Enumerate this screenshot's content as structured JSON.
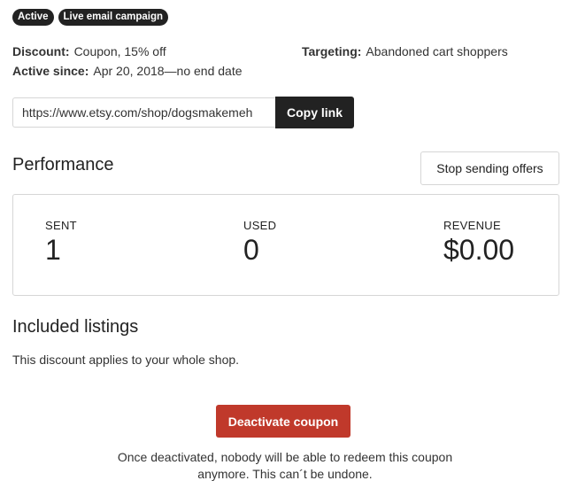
{
  "badges": [
    "Active",
    "Live email campaign"
  ],
  "details": {
    "discount_label": "Discount:",
    "discount_value": "Coupon, 15% off",
    "active_since_label": "Active since:",
    "active_since_value": "Apr 20, 2018—no end date",
    "targeting_label": "Targeting:",
    "targeting_value": "Abandoned cart shoppers"
  },
  "share": {
    "link_value": "https://www.etsy.com/shop/dogsmakemeh",
    "copy_label": "Copy link"
  },
  "performance": {
    "title": "Performance",
    "stop_label": "Stop sending offers",
    "stats": [
      {
        "label": "SENT",
        "value": "1"
      },
      {
        "label": "USED",
        "value": "0"
      },
      {
        "label": "REVENUE",
        "value": "$0.00"
      }
    ]
  },
  "listings": {
    "title": "Included listings",
    "description": "This discount applies to your whole shop."
  },
  "deactivate": {
    "button_label": "Deactivate coupon",
    "warning": "Once deactivated, nobody will be able to redeem this coupon anymore. This can´t be undone."
  },
  "colors": {
    "badge_bg": "#222222",
    "danger": "#c0392b"
  }
}
